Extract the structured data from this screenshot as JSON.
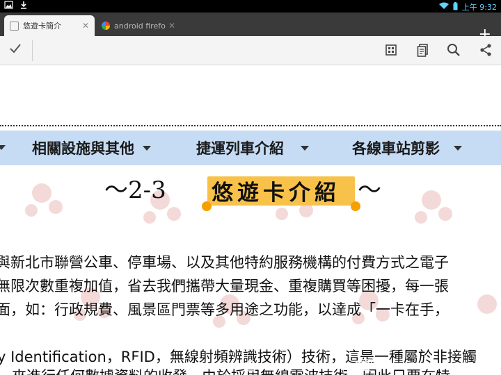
{
  "status_bar": {
    "time": "上午 9:32"
  },
  "tabs": [
    {
      "label": "悠遊卡簡介",
      "active": true
    },
    {
      "label": "android firefox",
      "active": false
    }
  ],
  "toolbar": {
    "icons": [
      "checkmark-icon",
      "reader-icon",
      "reading-list-icon",
      "search-icon",
      "share-icon"
    ]
  },
  "nav": {
    "items": [
      {
        "label": "相關設施與其他"
      },
      {
        "label": "捷運列車介紹"
      },
      {
        "label": "各線車站剪影"
      }
    ]
  },
  "heading": {
    "prefix": "～2-3",
    "title": "悠遊卡介紹",
    "suffix": "～"
  },
  "paragraphs": [
    "與新北市聯營公車、停車場、以及其他特約服務機構的付費方式之電子",
    "無限次數重複加值，省去我們攜帶大量現金、重複購買等困擾，每一張",
    "面，如：行政規費、風景區門票等多用途之功能，以達成「一卡在手，",
    "y Identification，RFID，無線射頻辨識技術）技術，這是一種屬於非接觸",
    "，來進行任何數據資料的收發，由於採用無線電波技術，因此只要在特"
  ],
  "colors": {
    "nav_bg": "#c6dcf5",
    "badge": "#f8c24a",
    "badge_dot": "#f5a000",
    "tab_strip": "#3a3a3a",
    "status_accent": "#5fd3ff"
  }
}
